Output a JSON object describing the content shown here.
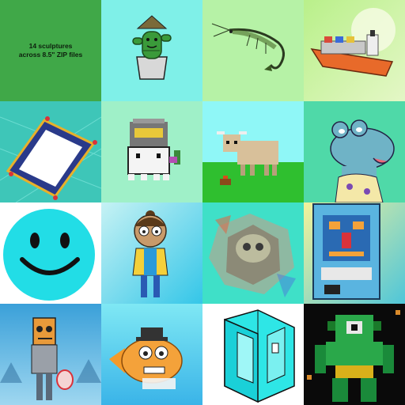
{
  "intro": {
    "line1": "14 sculptures",
    "line2": "across 8.5\" ZIP files"
  },
  "tiles": [
    {
      "id": "intro-card",
      "icon": "text-card"
    },
    {
      "id": "cactus-planter",
      "icon": "cactus-in-pot"
    },
    {
      "id": "shrimp",
      "icon": "shrimp-sketch"
    },
    {
      "id": "cargo-ship",
      "icon": "container-ship"
    },
    {
      "id": "magic-carpet",
      "icon": "carpet"
    },
    {
      "id": "pixel-knight",
      "icon": "pixel-helmet-ghost"
    },
    {
      "id": "pixel-ox",
      "icon": "pixel-yak"
    },
    {
      "id": "dino-tongue",
      "icon": "blue-dinosaur"
    },
    {
      "id": "smiley",
      "icon": "smiley-face"
    },
    {
      "id": "cartoon-woman",
      "icon": "cartoon-character"
    },
    {
      "id": "abstract-skull",
      "icon": "abstract-skull"
    },
    {
      "id": "robot-box",
      "icon": "robot-package"
    },
    {
      "id": "zombie-figure",
      "icon": "zombie"
    },
    {
      "id": "clown-fish",
      "icon": "fish-character"
    },
    {
      "id": "wireframe-cube",
      "icon": "isometric-cube"
    },
    {
      "id": "pixel-cyclops",
      "icon": "green-monster"
    }
  ],
  "colors": {
    "intro_bg": "#40a848",
    "accent_cyan": "#2ee6e6",
    "smiley_face": "#22dde6"
  }
}
